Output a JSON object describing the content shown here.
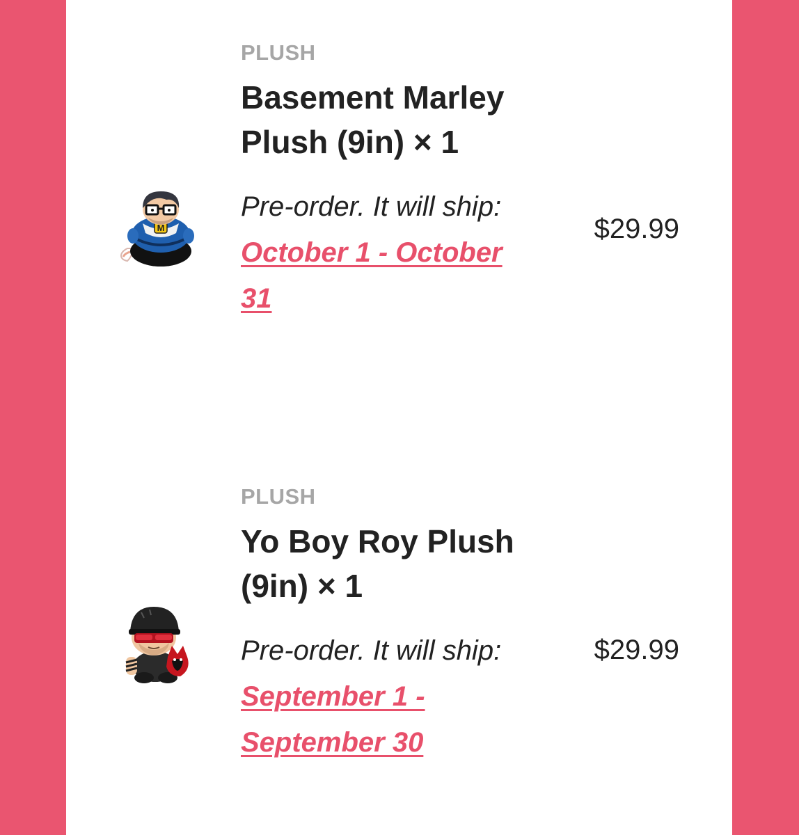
{
  "colors": {
    "background": "#ea5570",
    "panel": "#ffffff",
    "category": "#a6a6a6",
    "text": "#222222",
    "accent": "#e8506b"
  },
  "items": [
    {
      "category": "PLUSH",
      "title": "Basement Marley Plush (9in) × 1",
      "shipping_prefix": "Pre-order. It will ship: ",
      "ship_date": "October 1 - October 31",
      "price": "$29.99",
      "thumbnail_icon": "basement-marley-plush-icon"
    },
    {
      "category": "PLUSH",
      "title": "Yo Boy Roy Plush (9in) × 1",
      "shipping_prefix": "Pre-order. It will ship: ",
      "ship_date": "September 1 - September 30",
      "price": "$29.99",
      "thumbnail_icon": "yo-boy-roy-plush-icon"
    }
  ]
}
